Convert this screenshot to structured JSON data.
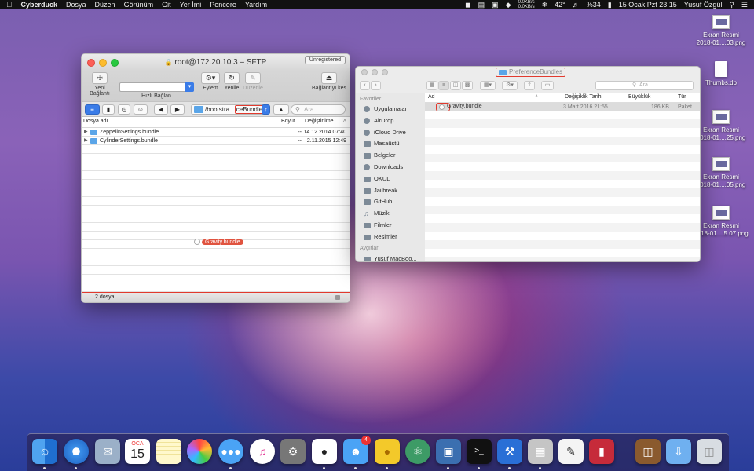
{
  "menubar": {
    "app": "Cyberduck",
    "menus": [
      "Dosya",
      "Düzen",
      "Görünüm",
      "Git",
      "Yer İmi",
      "Pencere",
      "Yardım"
    ],
    "net_up": "0.0KB/s",
    "net_down": "0.0KB/s",
    "temperature": "42°",
    "battery": "%34",
    "datetime": "15 Ocak Pzt  23 15",
    "user": "Yusuf Özgül"
  },
  "cyberduck": {
    "title": "root@172.20.10.3 – SFTP",
    "unregistered": "Unregistered",
    "toolbar": {
      "new_connection": "Yeni Bağlantı",
      "quick_connect": "Hızlı Bağlan",
      "action": "Eylem",
      "refresh": "Yenile",
      "edit": "Düzenle",
      "disconnect": "Bağlantıyı kes"
    },
    "path_prefix": "/bootstra...",
    "path_highlight": "ceBundles",
    "search_placeholder": "Ara",
    "columns": {
      "name": "Dosya adı",
      "size": "Boyut",
      "modified": "Değiştirilme"
    },
    "files": [
      {
        "name": "ZeppelinSettings.bundle",
        "size": "--",
        "modified": "14.12.2014 07:40"
      },
      {
        "name": "CylinderSettings.bundle",
        "size": "--",
        "modified": "2.11.2015 12:49"
      }
    ],
    "dragging": "Gravity.bundle",
    "status": "2 dosya"
  },
  "finder": {
    "title": "PreferenceBundles",
    "search_placeholder": "Ara",
    "sidebar_favorites_title": "Favoriler",
    "sidebar_items": [
      "Uygulamalar",
      "AirDrop",
      "iCloud Drive",
      "Masaüstü",
      "Belgeler",
      "Downloads",
      "OKUL",
      "Jailbreak",
      "GitHub",
      "Müzik",
      "Filmler",
      "Resimler"
    ],
    "sidebar_devices_title": "Aygıtlar",
    "sidebar_device": "Yusuf MacBoo...",
    "columns": {
      "name": "Ad",
      "modified": "Değişiklik Tarihi",
      "size": "Büyüklük",
      "kind": "Tür"
    },
    "row": {
      "name": "Gravity.bundle",
      "modified": "3 Mart 2016 21:55",
      "size": "186 KB",
      "kind": "Paket"
    }
  },
  "desktop_icons": [
    {
      "line1": "Ekran Resmi",
      "line2": "2018-01....03.png"
    },
    {
      "line1": "Thumbs.db",
      "line2": ""
    },
    {
      "line1": "Ekran Resmi",
      "line2": "2018-01....25.png"
    },
    {
      "line1": "Ekran Resmi",
      "line2": "2018-01....05.png"
    },
    {
      "line1": "Ekran Resmi",
      "line2": "2018-01....5.07.png"
    }
  ],
  "dock": {
    "calendar_month": "OCA",
    "calendar_day": "15",
    "tweetbot_badge": "4"
  }
}
